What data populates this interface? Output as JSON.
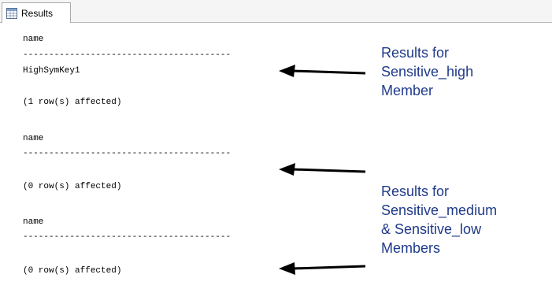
{
  "tab": {
    "label": "Results",
    "icon": "grid-results-icon"
  },
  "results": [
    {
      "column": "name",
      "separator": "----------------------------------------",
      "rows": [
        "HighSymKey1"
      ],
      "footer": "(1 row(s) affected)"
    },
    {
      "column": "name",
      "separator": "----------------------------------------",
      "rows": [],
      "footer": "(0 row(s) affected)"
    },
    {
      "column": "name",
      "separator": "----------------------------------------",
      "rows": [],
      "footer": "(0 row(s) affected)"
    }
  ],
  "annotations": [
    {
      "lines": [
        "Results for",
        "Sensitive_high",
        "Member"
      ]
    },
    {
      "lines": [
        "Results for",
        "Sensitive_medium",
        "& Sensitive_low",
        "Members"
      ]
    }
  ],
  "colors": {
    "annotation": "#1f3a8a",
    "arrow": "#000000"
  }
}
